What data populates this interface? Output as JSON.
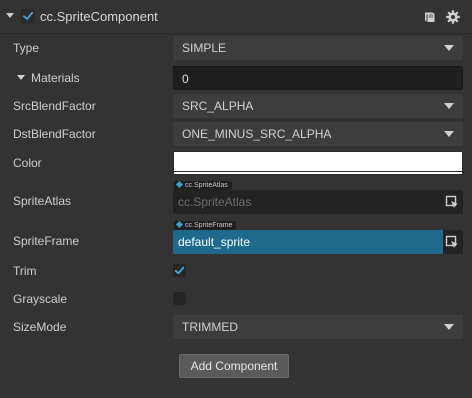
{
  "component": {
    "title": "cc.SpriteComponent",
    "enabled": true
  },
  "properties": {
    "type": {
      "label": "Type",
      "value": "SIMPLE"
    },
    "materials": {
      "label": "Materials",
      "value": "0"
    },
    "src_blend": {
      "label": "SrcBlendFactor",
      "value": "SRC_ALPHA"
    },
    "dst_blend": {
      "label": "DstBlendFactor",
      "value": "ONE_MINUS_SRC_ALPHA"
    },
    "color": {
      "label": "Color",
      "value": "#ffffff"
    },
    "sprite_atlas": {
      "label": "SpriteAtlas",
      "tag": "cc.SpriteAtlas",
      "placeholder": "cc.SpriteAtlas"
    },
    "sprite_frame": {
      "label": "SpriteFrame",
      "tag": "cc.SpriteFrame",
      "value": "default_sprite"
    },
    "trim": {
      "label": "Trim",
      "checked": true
    },
    "grayscale": {
      "label": "Grayscale",
      "checked": false
    },
    "size_mode": {
      "label": "SizeMode",
      "value": "TRIMMED"
    }
  },
  "buttons": {
    "add_component": "Add Component"
  },
  "icons": {
    "header_caret": "caret-down-icon",
    "help": "book-icon",
    "settings": "gear-icon",
    "asset_picker": "locate-asset-icon"
  },
  "colors": {
    "background": "#333333",
    "checkbox_tick": "#4aa3df",
    "selected_asset": "#1e6a8d",
    "asset_tag_dot": "#3aa0d8"
  }
}
